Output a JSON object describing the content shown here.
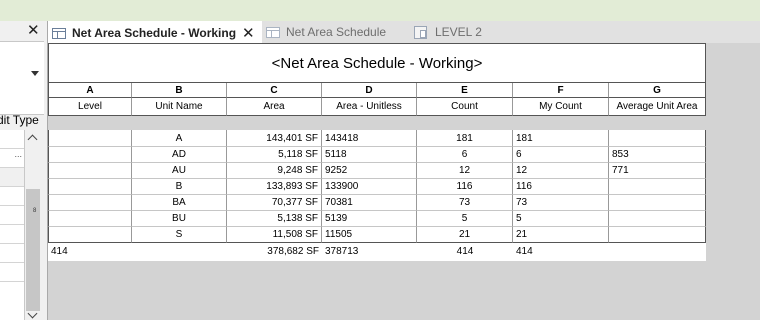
{
  "left_panel": {
    "close_glyph": "✕",
    "edit_type_label": "dit Type",
    "ellipsis": "...",
    "scroll_mark": "8"
  },
  "tabs": [
    {
      "label": "Net Area Schedule - Working",
      "icon": "schedule-icon",
      "active": true,
      "close_glyph": "✕"
    },
    {
      "label": "Net Area Schedule",
      "icon": "schedule-icon",
      "active": false
    },
    {
      "label": "LEVEL 2",
      "icon": "sheet-icon",
      "active": false
    }
  ],
  "schedule": {
    "title": "<Net Area Schedule - Working>",
    "column_letters": [
      "A",
      "B",
      "C",
      "D",
      "E",
      "F",
      "G"
    ],
    "column_headers": [
      "Level",
      "Unit Name",
      "Area",
      "Area - Unitless",
      "Count",
      "My Count",
      "Average Unit Area"
    ],
    "rows": [
      [
        "",
        "A",
        "143,401 SF",
        "143418",
        "181",
        "181",
        ""
      ],
      [
        "",
        "AD",
        "5,118 SF",
        "5118",
        "6",
        "6",
        "853"
      ],
      [
        "",
        "AU",
        "9,248 SF",
        "9252",
        "12",
        "12",
        "771"
      ],
      [
        "",
        "B",
        "133,893 SF",
        "133900",
        "116",
        "116",
        ""
      ],
      [
        "",
        "BA",
        "70,377 SF",
        "70381",
        "73",
        "73",
        ""
      ],
      [
        "",
        "BU",
        "5,138 SF",
        "5139",
        "5",
        "5",
        ""
      ],
      [
        "",
        "S",
        "11,508 SF",
        "11505",
        "21",
        "21",
        ""
      ]
    ],
    "totals": [
      "414",
      "",
      "378,682 SF",
      "378713",
      "414",
      "414",
      ""
    ]
  },
  "colors": {
    "top_band": "#e2ecd6",
    "background": "#d3d3d3",
    "tab_bar": "#e1e1e1"
  }
}
